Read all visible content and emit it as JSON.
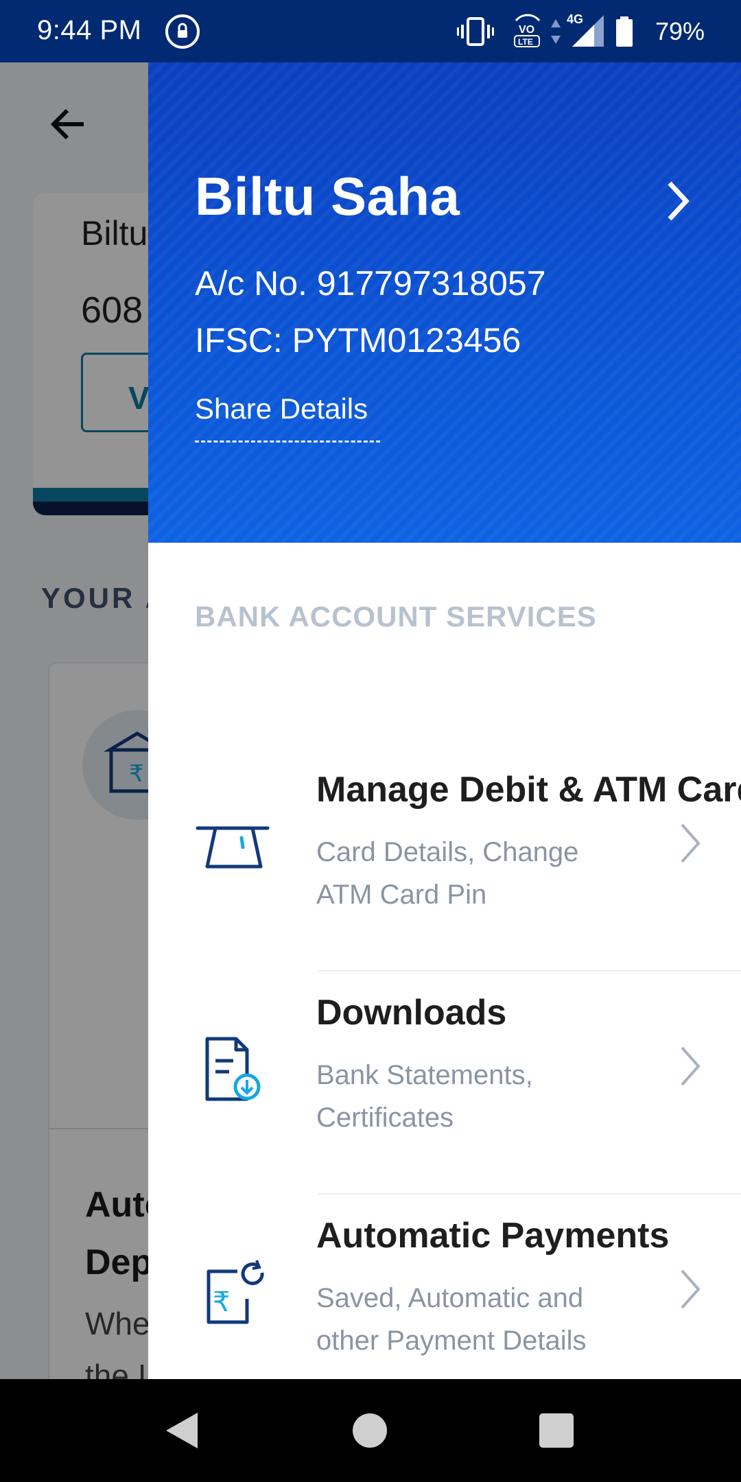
{
  "status_bar": {
    "time": "9:44 PM",
    "battery_percent": "79%",
    "network": "4G",
    "volte": "VO LTE"
  },
  "background_screen": {
    "card_name": "Biltu",
    "card_number": "608",
    "card_button": "V",
    "section_label": "YOUR A",
    "auto_title_line1": "Auto",
    "auto_title_line2": "Dep",
    "when_line1": "Whe",
    "when_line2": "the I"
  },
  "drawer": {
    "header": {
      "name": "Biltu Saha",
      "account_number": "A/c No. 917797318057",
      "ifsc": "IFSC: PYTM0123456",
      "share_label": "Share Details"
    },
    "section_title": "BANK ACCOUNT SERVICES",
    "items": [
      {
        "title": "Manage Debit & ATM Card",
        "subtitle": "Card Details, Change ATM Card Pin",
        "icon": "atm-card-icon"
      },
      {
        "title": "Downloads",
        "subtitle": "Bank Statements, Certificates",
        "icon": "download-document-icon"
      },
      {
        "title": "Automatic Payments",
        "subtitle": "Saved, Automatic and other Payment Details",
        "icon": "auto-payment-icon"
      }
    ]
  },
  "colors": {
    "status_bar": "#022a72",
    "drawer_header": "#0752cc",
    "icon_blue": "#123a7a",
    "icon_accent": "#16a8e0"
  }
}
